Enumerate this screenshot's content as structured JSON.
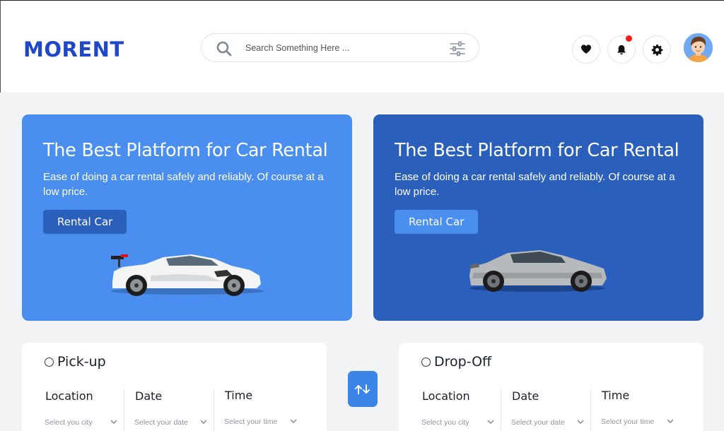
{
  "app": {
    "logo": "MORENT"
  },
  "search": {
    "placeholder": "Search Something Here ..."
  },
  "header_actions": {
    "icons": [
      "heart-icon",
      "bell-icon",
      "gear-icon"
    ],
    "notification_dot_color": "#ff1a1a"
  },
  "banners": [
    {
      "title": "The Best Platform for Car Rental",
      "text": "Ease of doing a car rental safely and reliably. Of course at a low price.",
      "button": "Rental Car",
      "bg_color": "#4a8ff0"
    },
    {
      "title": "The Best Platform for Car Rental",
      "text": "Ease of doing a car rental safely and reliably. Of course at a low price.",
      "button": "Rental Car",
      "bg_color": "#2b5fbc"
    }
  ],
  "pickup": {
    "title": "Pick-up",
    "location_label": "Location",
    "location_placeholder": "Select you city",
    "date_label": "Date",
    "date_placeholder": "Select your date",
    "time_label": "Time",
    "time_placeholder": "Select your time"
  },
  "dropoff": {
    "title": "Drop-Off",
    "location_label": "Location",
    "location_placeholder": "Select you city",
    "date_label": "Date",
    "date_placeholder": "Select your date",
    "time_label": "Time",
    "time_placeholder": "Select your time"
  },
  "colors": {
    "brand": "#1f47c9",
    "accent": "#3b84e8"
  }
}
